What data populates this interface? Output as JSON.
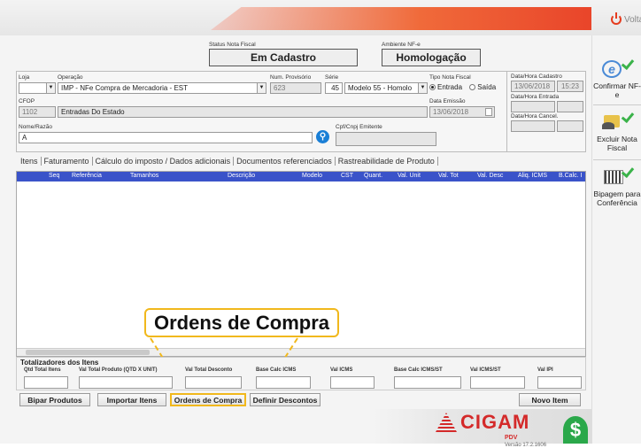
{
  "top": {
    "voltar_label": "Voltar"
  },
  "status": {
    "label": "Status Nota Fiscal",
    "value": "Em Cadastro",
    "ambiente_label": "Ambiente NF-e",
    "ambiente_value": "Homologação"
  },
  "form": {
    "loja_label": "Loja",
    "operacao_label": "Operação",
    "operacao_value": "IMP - NFe Compra de Mercadoria - EST",
    "num_prov_label": "Num. Provisório",
    "num_prov_value": "623",
    "serie_label": "Série",
    "serie_value": "45",
    "modelo_value": "Modelo 55 - Homolo",
    "tipo_label": "Tipo Nota Fiscal",
    "tipo_entrada": "Entrada",
    "tipo_saida": "Saída",
    "cfop_label": "CFOP",
    "cfop_code": "1102",
    "cfop_desc": "Entradas Do Estado",
    "emissao_label": "Data Emissão",
    "emissao_value": "13/06/2018",
    "nome_label": "Nome/Razão",
    "nome_value": "A",
    "cpf_label": "Cpf/Cnpj Emitente",
    "cadastro_label": "Data/Hora Cadastro",
    "cadastro_date": "13/06/2018",
    "cadastro_time": "15:23",
    "entrada_label": "Data/Hora Entrada",
    "cancel_label": "Data/Hora Cancel."
  },
  "tabs": [
    "Itens",
    "Faturamento",
    "Cálculo do imposto / Dados adicionais",
    "Documentos referenciados",
    "Rastreabilidade de Produto"
  ],
  "grid": {
    "columns": [
      "Seq",
      "Referência",
      "Tamanhos",
      "Descrição",
      "Modelo",
      "CST",
      "Quant.",
      "Val. Unit",
      "Val. Tot",
      "Val. Desc",
      "Aliq. ICMS",
      "B.Calc. I"
    ]
  },
  "totals": {
    "title": "Totalizadores dos Itens",
    "labels": [
      "Qtd Total Itens",
      "Val Total Produto (QTD X UNIT)",
      "Val Total Desconto",
      "Base Calc ICMS",
      "Val ICMS",
      "Base Calc ICMS/ST",
      "Val ICMS/ST",
      "Val IPI"
    ]
  },
  "buttons": {
    "bipar": "Bipar Produtos",
    "importar": "Importar Itens",
    "ordens": "Ordens de Compra",
    "descontos": "Definir Descontos",
    "novo": "Novo Item"
  },
  "callout": {
    "text": "Ordens de Compra"
  },
  "sidebar": {
    "confirmar": "Confirmar NF-e",
    "excluir": "Excluir Nota Fiscal",
    "bipagem": "Bipagem para Conferência"
  },
  "footer": {
    "brand": "CIGAM",
    "sub": "PDV",
    "version": "Versão 17.2.1606"
  },
  "colors": {
    "accent_red": "#e9452a",
    "grid_header": "#3a53c9",
    "highlight": "#f1b81c",
    "check_green": "#3bb34a"
  }
}
